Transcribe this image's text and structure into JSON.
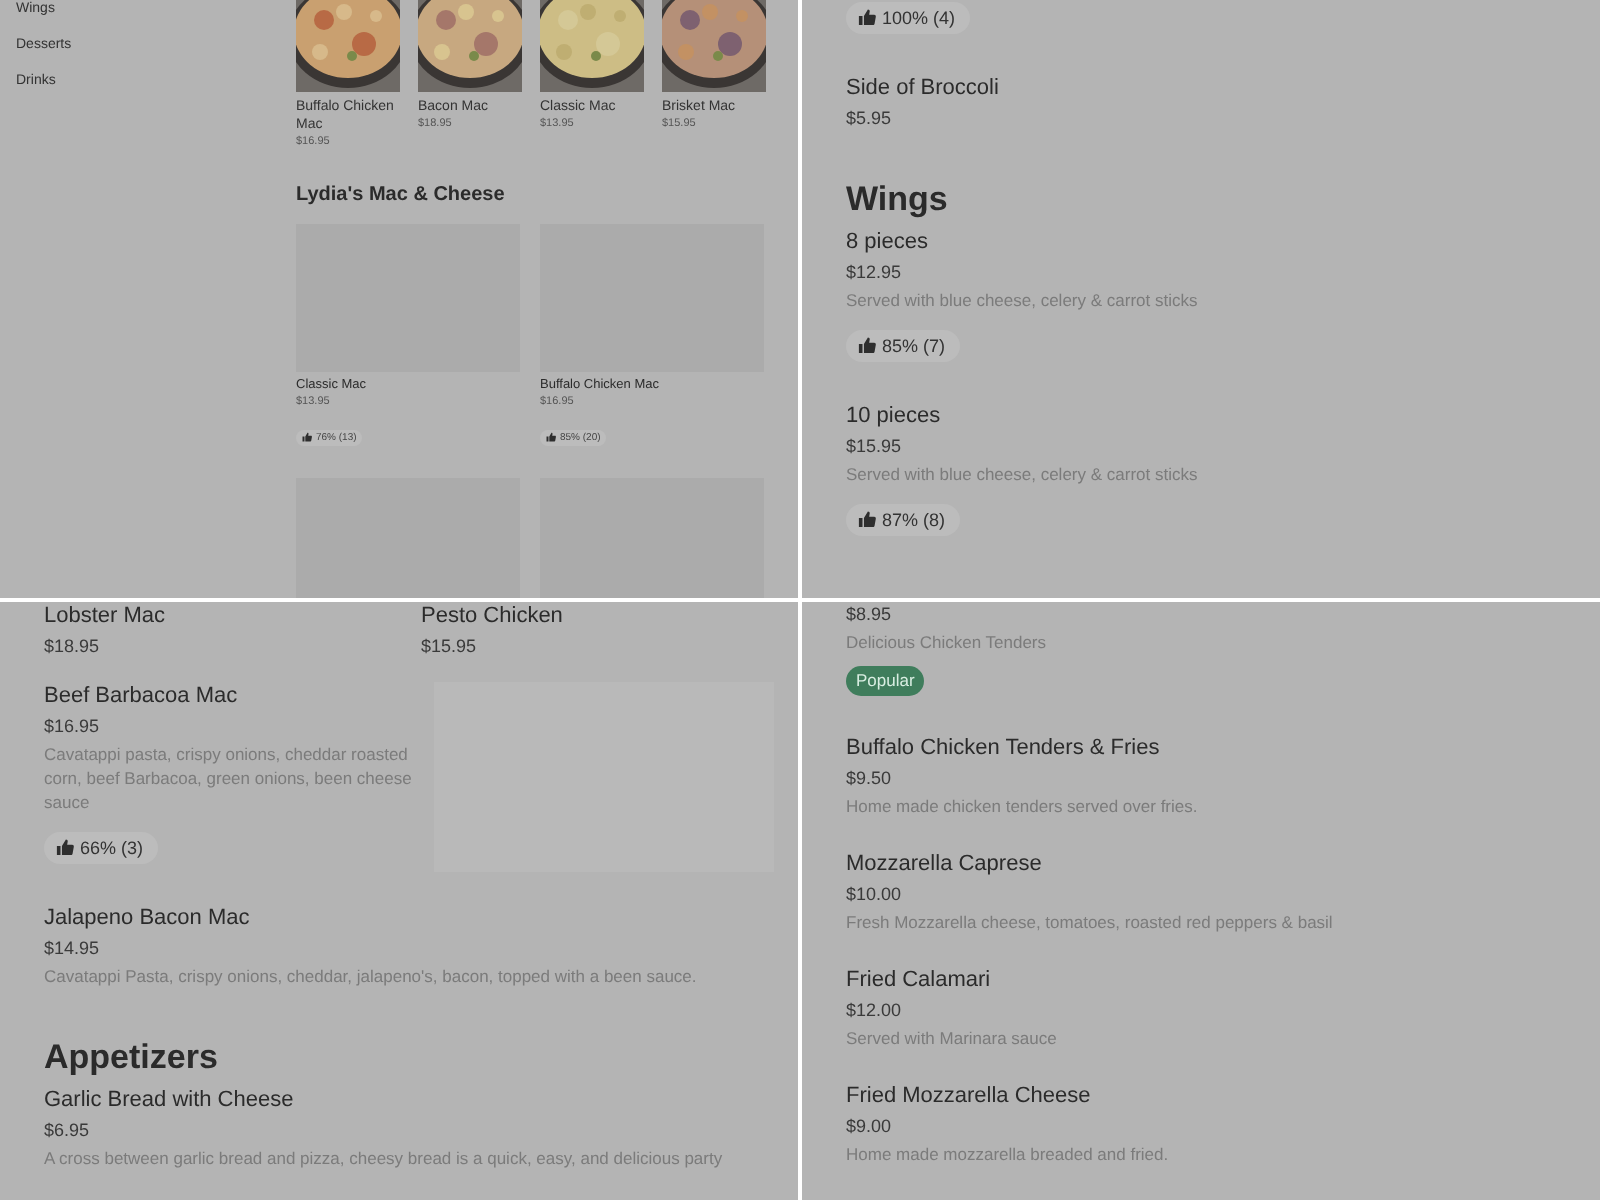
{
  "panels": [
    {
      "kind": "category",
      "sidebar": {
        "items": [
          {
            "label": "Wings"
          },
          {
            "label": "Desserts"
          },
          {
            "label": "Drinks"
          }
        ]
      },
      "featured": [
        {
          "name": "Buffalo Chicken Mac",
          "price": "$16.95"
        },
        {
          "name": "Bacon Mac",
          "price": "$18.95"
        },
        {
          "name": "Classic Mac",
          "price": "$13.95"
        },
        {
          "name": "Brisket Mac",
          "price": "$15.95"
        }
      ],
      "section": {
        "title": "Lydia's Mac & Cheese",
        "cards": [
          {
            "kind": "item",
            "name": "Classic Mac",
            "price": "$13.95",
            "rating": "76% (13)"
          },
          {
            "kind": "item",
            "name": "Buffalo Chicken Mac",
            "price": "$16.95",
            "rating": "85% (20)"
          },
          {
            "kind": "picture"
          },
          {
            "kind": "picture"
          }
        ]
      }
    },
    {
      "kind": "menu",
      "blocks": [
        {
          "kind": "rating",
          "text": "100% (4)"
        },
        {
          "kind": "item",
          "name": "Side of Broccoli",
          "price": "$5.95"
        },
        {
          "kind": "heading",
          "text": "Wings"
        },
        {
          "kind": "item",
          "name": "8 pieces",
          "price": "$12.95",
          "description": "Served with blue cheese, celery & carrot sticks",
          "rating": "85% (7)"
        },
        {
          "kind": "item",
          "name": "10 pieces",
          "price": "$15.95",
          "description": "Served with blue cheese, celery & carrot sticks",
          "rating": "87% (8)"
        }
      ]
    },
    {
      "kind": "menu",
      "blocks": [
        {
          "kind": "pair",
          "items": [
            {
              "name": "Lobster Mac",
              "price": "$18.95"
            },
            {
              "name": "Pesto Chicken",
              "price": "$15.95"
            }
          ]
        },
        {
          "kind": "item",
          "name": "Beef Barbacoa Mac",
          "price": "$16.95",
          "description": "Cavatappi pasta, crispy onions, cheddar roasted corn, beef Barbacoa, green onions, been cheese sauce",
          "rating": "66% (3)",
          "image": true
        },
        {
          "kind": "item",
          "name": "Jalapeno Bacon Mac",
          "price": "$14.95",
          "description": "Cavatappi Pasta, crispy onions, cheddar, jalapeno's, bacon, topped with a been sauce."
        },
        {
          "kind": "heading",
          "text": "Appetizers"
        },
        {
          "kind": "item",
          "name": "Garlic Bread with Cheese",
          "price": "$6.95",
          "description": "A cross between garlic bread and pizza, cheesy bread is a quick, easy, and delicious party"
        }
      ]
    },
    {
      "kind": "menu",
      "blocks": [
        {
          "kind": "item",
          "price": "$8.95",
          "description": "Delicious Chicken Tenders",
          "badge": "Popular"
        },
        {
          "kind": "item",
          "name": "Buffalo Chicken Tenders & Fries",
          "price": "$9.50",
          "description": "Home made chicken tenders served over fries."
        },
        {
          "kind": "item",
          "name": "Mozzarella Caprese",
          "price": "$10.00",
          "description": "Fresh Mozzarella cheese, tomatoes, roasted red peppers & basil"
        },
        {
          "kind": "item",
          "name": "Fried Calamari",
          "price": "$12.00",
          "description": "Served with Marinara sauce"
        },
        {
          "kind": "item",
          "name": "Fried Mozzarella Cheese",
          "price": "$9.00",
          "description": "Home made mozzarella breaded and fried."
        }
      ]
    }
  ]
}
